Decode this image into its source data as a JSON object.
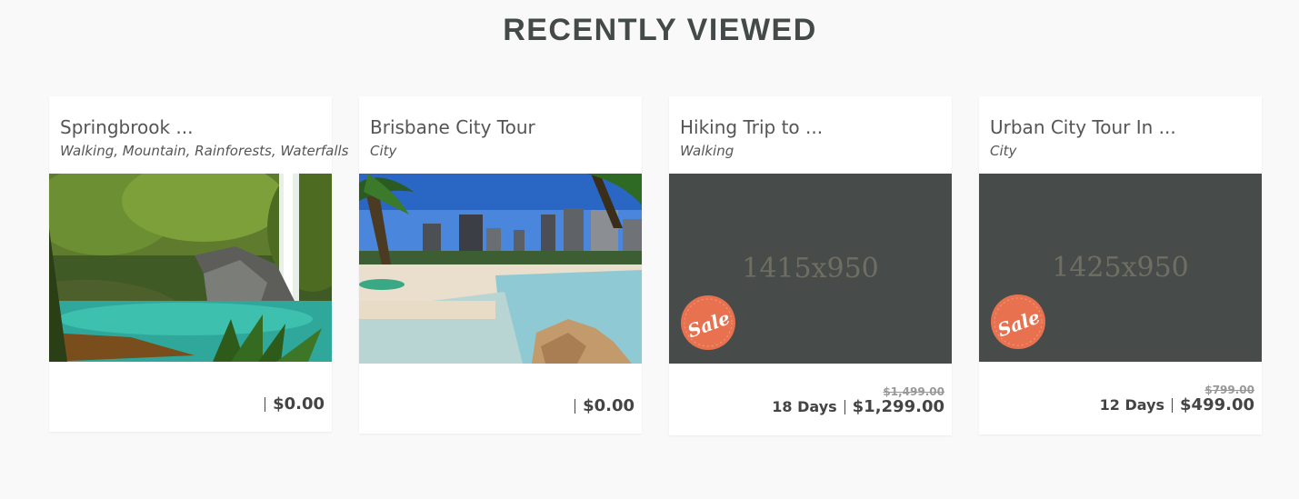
{
  "section": {
    "title": "RECENTLY VIEWED"
  },
  "cards": [
    {
      "title": "Springbrook ...",
      "tags": "Walking, Mountain, Rainforests, Waterfalls",
      "image": "waterfall-photo",
      "duration": "",
      "price": "$0.00",
      "old_price": ""
    },
    {
      "title": "Brisbane City Tour",
      "tags": "City",
      "image": "city-beach-photo",
      "duration": "",
      "price": "$0.00",
      "old_price": ""
    },
    {
      "title": "Hiking Trip to ...",
      "tags": "Walking",
      "image": "placeholder",
      "placeholder_text": "1415x950",
      "sale": "Sale",
      "duration": "18 Days",
      "price": "$1,299.00",
      "old_price": "$1,499.00"
    },
    {
      "title": "Urban City Tour In ...",
      "tags": "City",
      "image": "placeholder",
      "placeholder_text": "1425x950",
      "sale": "Sale",
      "duration": "12 Days",
      "price": "$499.00",
      "old_price": "$799.00"
    }
  ],
  "colors": {
    "background": "#f9f9f9",
    "placeholder": "#474c4a",
    "sale_badge": "#e8724f",
    "text": "#444a49"
  }
}
